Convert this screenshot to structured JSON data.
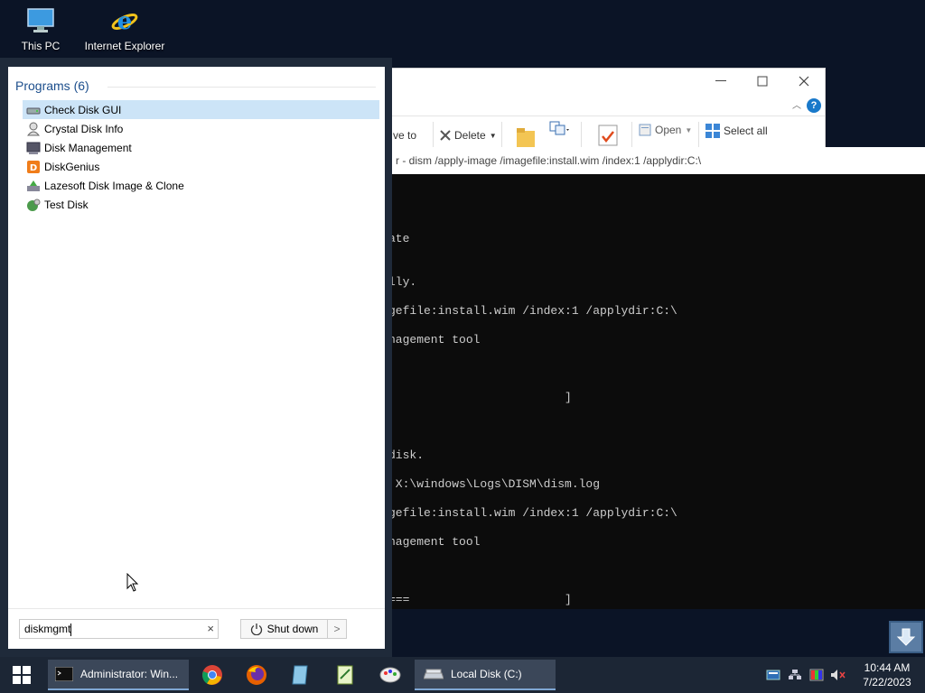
{
  "desktop": {
    "icons": [
      {
        "label": "This PC",
        "icon": "computer-icon"
      },
      {
        "label": "Internet Explorer",
        "icon": "internet-explorer-icon"
      }
    ]
  },
  "explorer": {
    "ribbon": {
      "move_to_label": "ve to",
      "delete_label": "Delete",
      "open_label": "Open",
      "select_all_label": "Select all"
    },
    "help_label": "?"
  },
  "console": {
    "title": "r - dism  /apply-image /imagefile:install.wim /index:1 /applydir:C:\\",
    "lines": [
      "ate",
      "lly.",
      "gefile:install.wim /index:1 /applydir:C:\\",
      "nagement tool",
      "                         ]",
      "disk.",
      " X:\\windows\\Logs\\DISM\\dism.log",
      "gefile:install.wim /index:1 /applydir:C:\\",
      "nagement tool",
      "===                      ]"
    ]
  },
  "start_menu": {
    "header": "Programs (6)",
    "programs": [
      {
        "label": "Check Disk GUI",
        "icon": "disk-check-icon",
        "selected": true
      },
      {
        "label": "Crystal Disk Info",
        "icon": "crystal-disk-icon",
        "selected": false
      },
      {
        "label": "Disk Management",
        "icon": "disk-management-icon",
        "selected": false
      },
      {
        "label": "DiskGenius",
        "icon": "diskgenius-icon",
        "selected": false
      },
      {
        "label": "Lazesoft Disk Image & Clone",
        "icon": "lazesoft-icon",
        "selected": false
      },
      {
        "label": "Test Disk",
        "icon": "testdisk-icon",
        "selected": false
      }
    ],
    "search": {
      "value": "diskmgmt",
      "clear": "×"
    },
    "shutdown_label": "Shut down",
    "shutdown_arrow": ">"
  },
  "taskbar": {
    "tasks": [
      {
        "label": "Administrator: Win...",
        "icon": "cmd-icon"
      },
      {
        "label": "Local Disk (C:)",
        "icon": "drive-icon"
      }
    ],
    "pinned": [
      "chrome-icon",
      "firefox-icon",
      "notepad-icon",
      "notes-icon",
      "paint-icon"
    ],
    "tray": [
      "keyboard-icon",
      "network-icon",
      "color-icon",
      "volume-muted-icon"
    ],
    "clock": {
      "time": "10:44 AM",
      "date": "7/22/2023"
    }
  }
}
